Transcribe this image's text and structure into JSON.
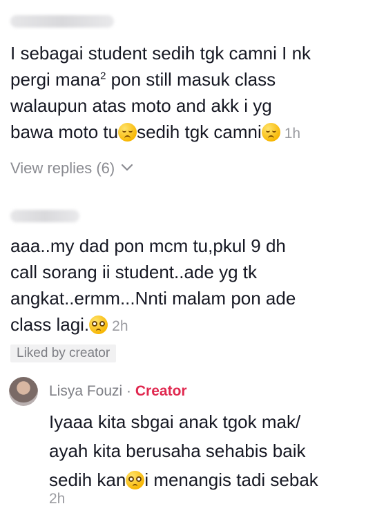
{
  "comment1": {
    "line1": "I sebagai student sedih tgk camni I nk",
    "line2_pre": "pergi mana",
    "line2_sup": "2",
    "line2_post": " pon still masuk class",
    "line3": "walaupun atas moto and akk i yg",
    "line4_a": "bawa moto tu",
    "line4_b": "sedih tgk camni",
    "timestamp": "1h",
    "emoji": "relieved-face"
  },
  "view_replies": {
    "label": "View replies (6)",
    "icon": "chevron-down"
  },
  "comment2": {
    "line1": "aaa..my dad pon mcm tu,pkul 9 dh",
    "line2": "call sorang ii student..ade yg tk",
    "line3": "angkat..ermm...Nnti malam pon ade",
    "line4": "class lagi.",
    "timestamp": "2h",
    "emoji": "pleading-face",
    "badge": "Liked by creator"
  },
  "reply": {
    "author": "Lisya Fouzi",
    "separator": " · ",
    "role": "Creator",
    "line1": "Iyaaa kita sbgai anak tgok mak/",
    "line2": "ayah kita berusaha sehabis baik",
    "line3_a": "sedih kan",
    "line3_b": "i menangis tadi sebak",
    "timestamp": "2h",
    "emoji": "pleading-face"
  },
  "colors": {
    "text": "#161823",
    "muted": "#8a8b91",
    "creator": "#e0284f",
    "badge_bg": "#f1f1f2"
  }
}
